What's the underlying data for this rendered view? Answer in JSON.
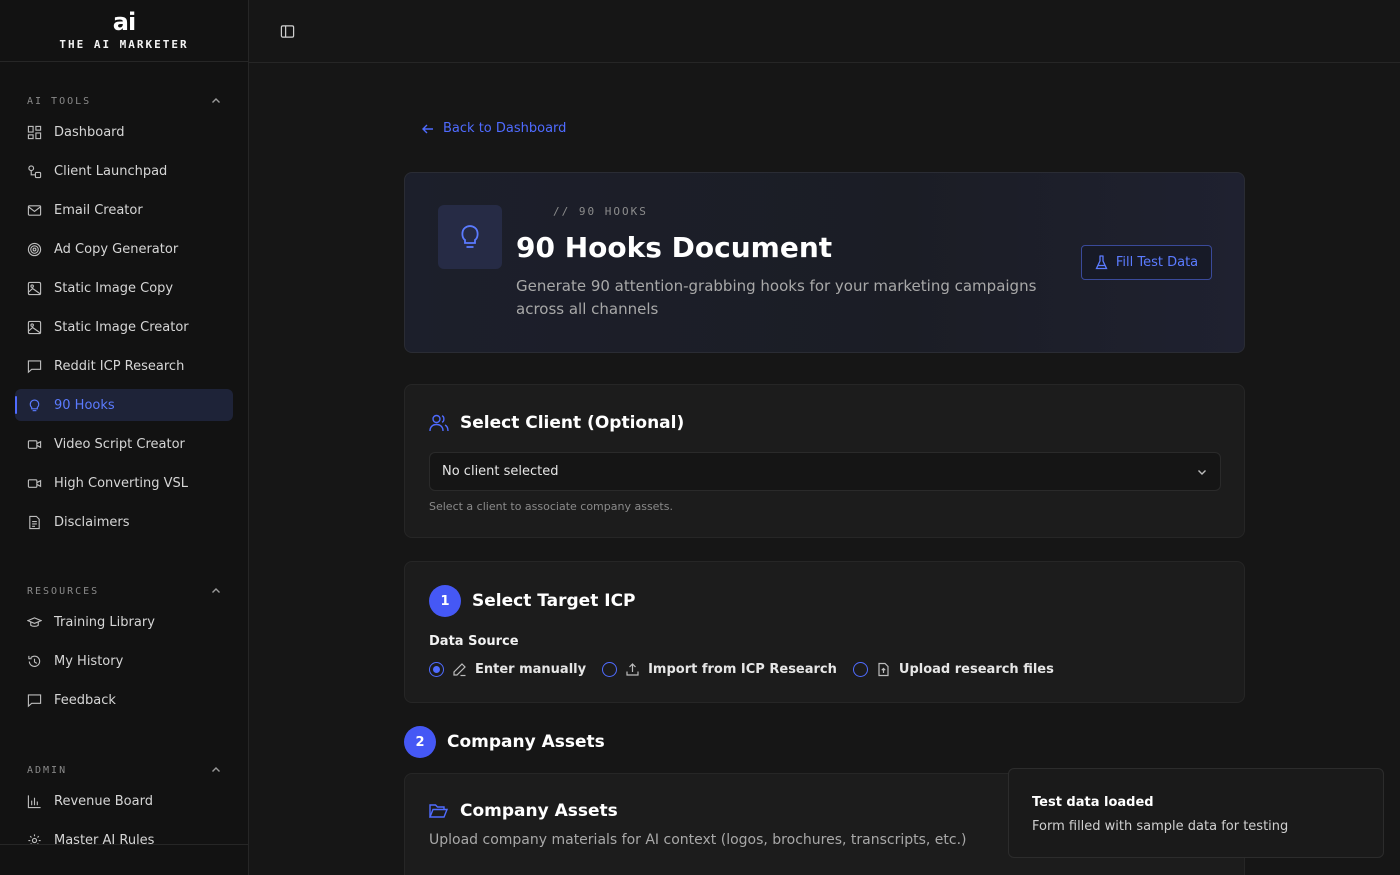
{
  "brand": {
    "mark": "ai",
    "name": "THE AI MARKETER"
  },
  "sidebar": {
    "sections": [
      {
        "title": "AI TOOLS",
        "items": [
          {
            "label": "Dashboard",
            "icon": "dashboard-icon"
          },
          {
            "label": "Client Launchpad",
            "icon": "launchpad-icon"
          },
          {
            "label": "Email Creator",
            "icon": "mail-icon"
          },
          {
            "label": "Ad Copy Generator",
            "icon": "target-icon"
          },
          {
            "label": "Static Image Copy",
            "icon": "image-icon"
          },
          {
            "label": "Static Image Creator",
            "icon": "image-icon"
          },
          {
            "label": "Reddit ICP Research",
            "icon": "message-icon"
          },
          {
            "label": "90 Hooks",
            "icon": "lightbulb-icon",
            "active": true
          },
          {
            "label": "Video Script Creator",
            "icon": "video-icon"
          },
          {
            "label": "High Converting VSL",
            "icon": "video-icon"
          },
          {
            "label": "Disclaimers",
            "icon": "document-icon"
          }
        ]
      },
      {
        "title": "RESOURCES",
        "items": [
          {
            "label": "Training Library",
            "icon": "graduation-cap-icon"
          },
          {
            "label": "My History",
            "icon": "history-icon"
          },
          {
            "label": "Feedback",
            "icon": "message-icon"
          }
        ]
      },
      {
        "title": "ADMIN",
        "items": [
          {
            "label": "Revenue Board",
            "icon": "bar-chart-icon"
          },
          {
            "label": "Master AI Rules",
            "icon": "gear-icon"
          }
        ]
      }
    ]
  },
  "main": {
    "back_label": "Back to Dashboard",
    "hero": {
      "kicker": "// 90 HOOKS",
      "title": "90 Hooks Document",
      "subtitle": "Generate 90 attention-grabbing hooks for your marketing campaigns across all channels",
      "fill_button": "Fill Test Data"
    },
    "client_card": {
      "title": "Select Client (Optional)",
      "select_value": "No client selected",
      "helper": "Select a client to associate company assets."
    },
    "icp_card": {
      "step": "1",
      "title": "Select Target ICP",
      "data_source_label": "Data Source",
      "options": [
        "Enter manually",
        "Import from ICP Research",
        "Upload research files"
      ],
      "selected_option": "Enter manually"
    },
    "assets_section": {
      "step": "2",
      "title": "Company Assets",
      "card_title": "Company Assets",
      "card_desc": "Upload company materials for AI context (logos, brochures, transcripts, etc.)"
    }
  },
  "toast": {
    "title": "Test data loaded",
    "description": "Form filled with sample data for testing"
  },
  "colors": {
    "accent": "#4f6bff",
    "background": "#161616",
    "sidebar": "#121212"
  }
}
